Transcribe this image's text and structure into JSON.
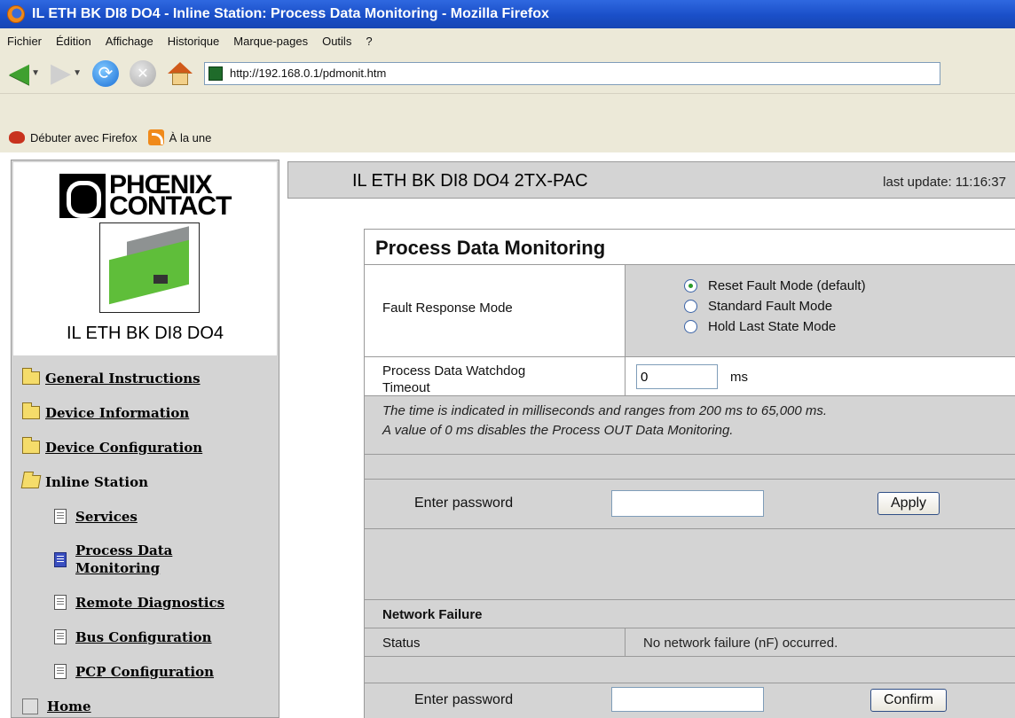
{
  "window": {
    "title": "IL ETH BK DI8 DO4 - Inline Station: Process Data Monitoring - Mozilla Firefox"
  },
  "menubar": {
    "items": [
      "Fichier",
      "Édition",
      "Affichage",
      "Historique",
      "Marque-pages",
      "Outils",
      "?"
    ]
  },
  "navbar": {
    "url": "http://192.168.0.1/pdmonit.htm"
  },
  "bookmarks": {
    "items": [
      "Débuter avec Firefox",
      "À la une"
    ]
  },
  "sidebar": {
    "brand_line1": "PHŒNIX",
    "brand_line2": "CONTACT",
    "device_name": "IL ETH BK DI8 DO4",
    "items": [
      {
        "label": "General Instructions"
      },
      {
        "label": "Device Information"
      },
      {
        "label": "Device Configuration"
      },
      {
        "label": "Inline Station"
      },
      {
        "label": "Services"
      },
      {
        "label": "Process Data"
      },
      {
        "label": "Monitoring"
      },
      {
        "label": "Remote Diagnostics"
      },
      {
        "label": "Bus Configuration"
      },
      {
        "label": "PCP Configuration"
      },
      {
        "label": "Home"
      }
    ]
  },
  "header": {
    "title": "IL ETH BK DI8 DO4 2TX-PAC",
    "last_update_label": "last update:",
    "last_update_time": "11:16:37"
  },
  "panel": {
    "title": "Process Data Monitoring",
    "fault_label": "Fault Response Mode",
    "fault_options": [
      {
        "label": "Reset Fault Mode (default)",
        "checked": true
      },
      {
        "label": "Standard Fault Mode",
        "checked": false
      },
      {
        "label": "Hold Last State Mode",
        "checked": false
      }
    ],
    "watchdog_label_line1": "Process Data Watchdog",
    "watchdog_label_line2": "Timeout",
    "watchdog_value": "0",
    "watchdog_unit": "ms",
    "info_line1": "The time is indicated in milliseconds and ranges from 200 ms to 65,000 ms.",
    "info_line2": "A value of 0 ms disables the Process OUT Data Monitoring.",
    "password_label": "Enter password",
    "apply_label": "Apply",
    "network_title": "Network Failure",
    "status_label": "Status",
    "status_value": "No network failure (nF) occurred.",
    "password_label2": "Enter password",
    "confirm_label": "Confirm"
  },
  "colors": {
    "titlebar": "#1a4fc8",
    "chrome": "#ece9d8",
    "panel_gray": "#d4d4d4",
    "border": "#9a9a9a"
  }
}
